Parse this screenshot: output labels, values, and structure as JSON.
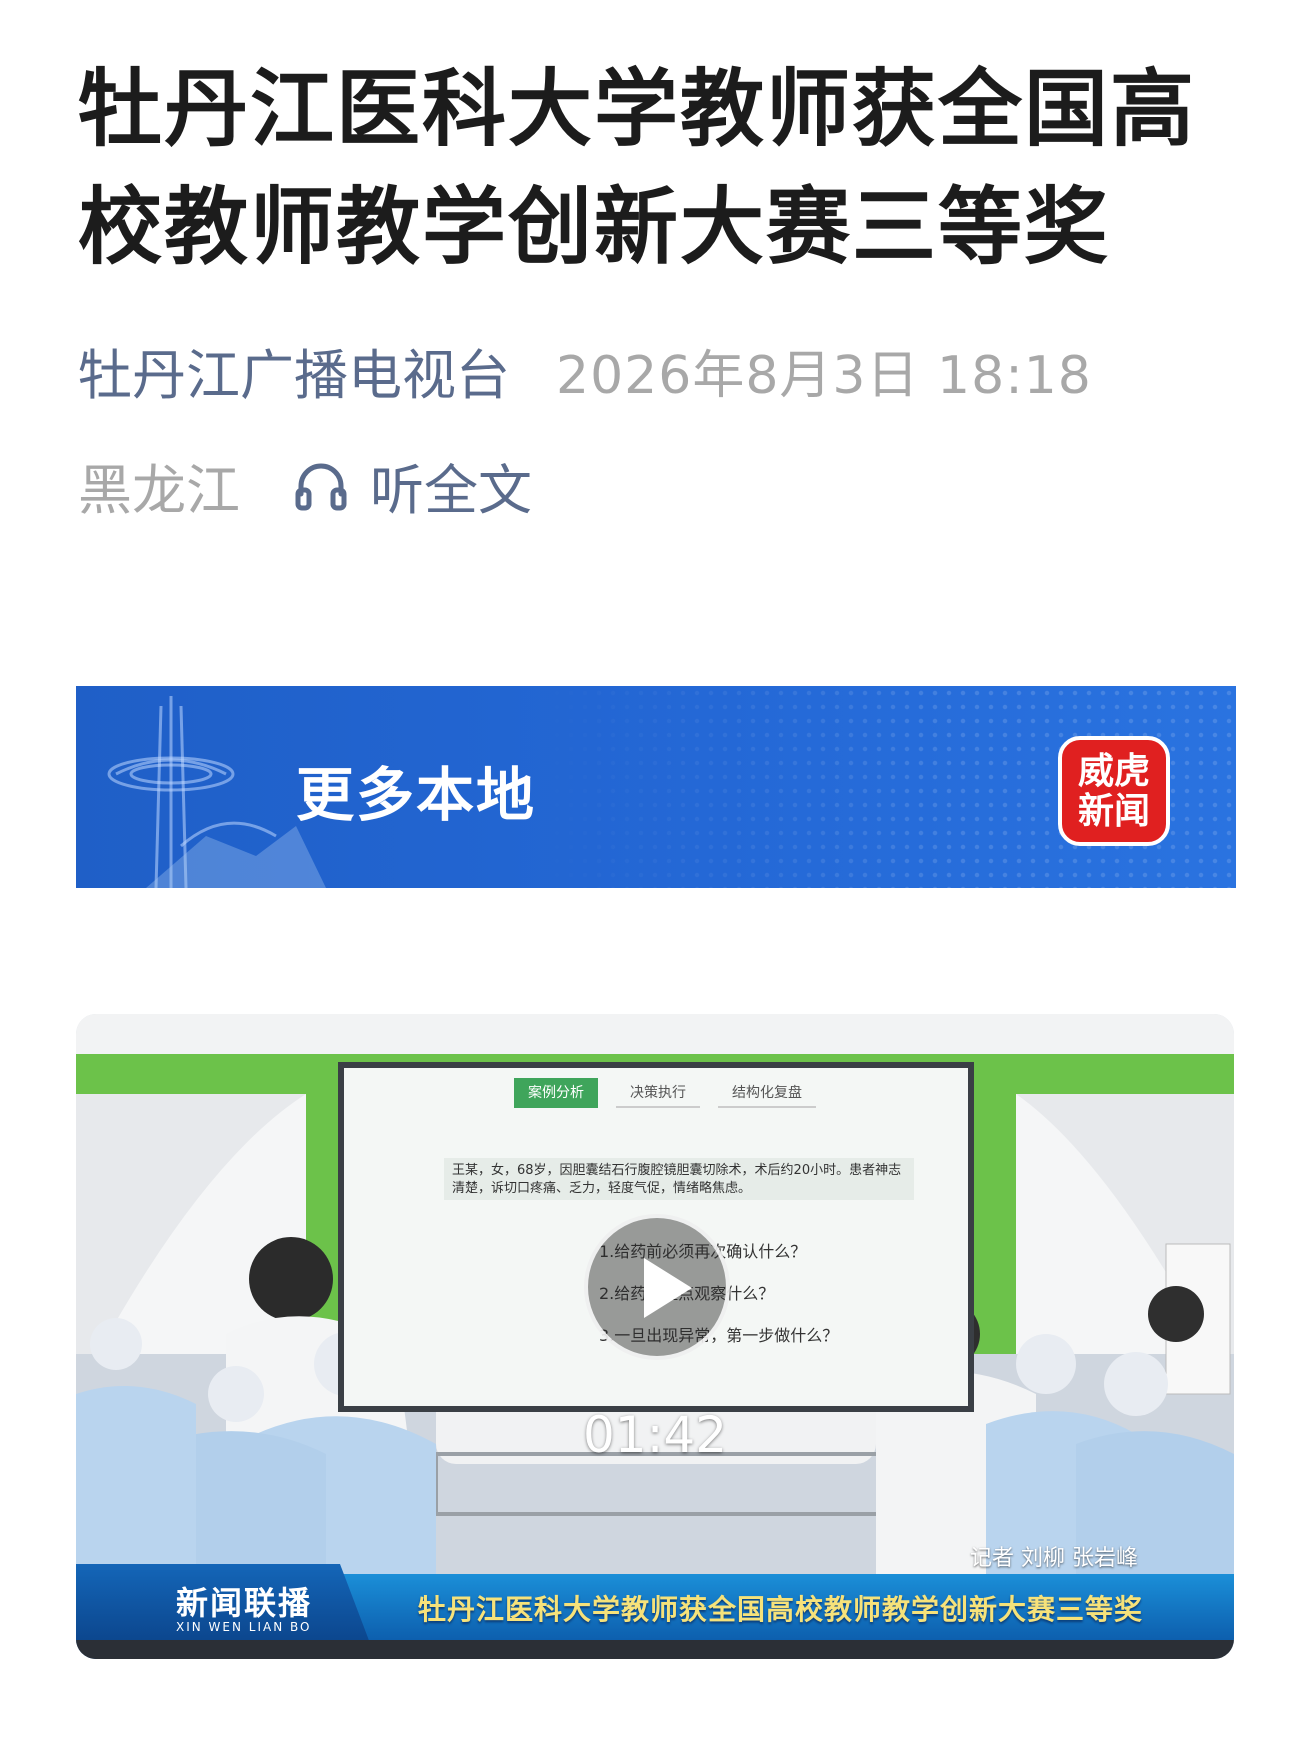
{
  "article": {
    "title": "牡丹江医科大学教师获全国高校教师教学创新大赛三等奖",
    "source": "牡丹江广播电视台",
    "datetime": "2026年8月3日 18:18",
    "region": "黑龙江",
    "listen_label": "听全文",
    "listen_icon": "headphones-icon"
  },
  "banner": {
    "label": "更多本地",
    "logo_line1": "威虎",
    "logo_line2": "新闻",
    "logo_color": "#e02020",
    "background": "#2468d6"
  },
  "video": {
    "duration": "01:42",
    "play_icon": "play-icon",
    "reporter": "记者 刘柳 张岩峰",
    "program_name": "新闻联播",
    "program_pinyin": "XIN WEN LIAN BO",
    "headline": "牡丹江医科大学教师获全国高校教师教学创新大赛三等奖",
    "screen": {
      "tabs": [
        "案例分析",
        "决策执行",
        "结构化复盘"
      ],
      "case_text": "王某，女，68岁，因胆囊结石行腹腔镜胆囊切除术，术后约20小时。患者神志清楚，诉切口疼痛、乏力，轻度气促，情绪略焦虑。",
      "questions": [
        "1.给药前必须再次确认什么？",
        "2.给药后重点观察什么？",
        "3.一旦出现异常，第一步做什么？"
      ]
    }
  }
}
